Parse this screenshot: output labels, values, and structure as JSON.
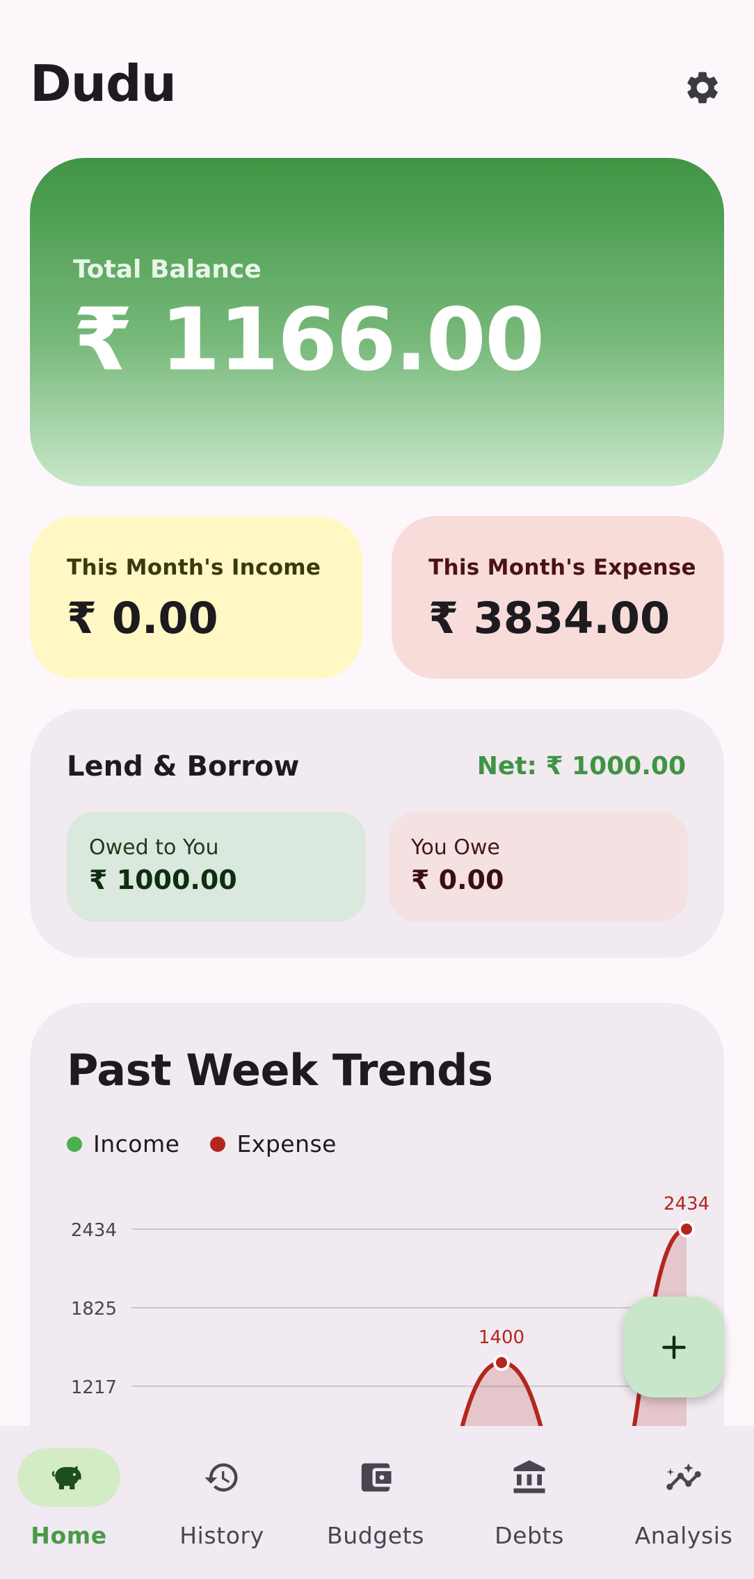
{
  "header": {
    "title": "Dudu",
    "settings_icon": "gear-icon"
  },
  "balance": {
    "label": "Total Balance",
    "value": "₹ 1166.00"
  },
  "income": {
    "label": "This Month's Income",
    "value": "₹ 0.00"
  },
  "expense": {
    "label": "This Month's Expense",
    "value": "₹ 3834.00"
  },
  "lend_borrow": {
    "title": "Lend & Borrow",
    "net": "Net: ₹ 1000.00",
    "owed_to_you": {
      "label": "Owed to You",
      "value": "₹ 1000.00"
    },
    "you_owe": {
      "label": "You Owe",
      "value": "₹ 0.00"
    }
  },
  "trends": {
    "title": "Past Week Trends",
    "legend": {
      "income": "Income",
      "expense": "Expense"
    }
  },
  "chart_data": {
    "type": "area",
    "y_ticks": [
      2434,
      1825,
      1217
    ],
    "ylim": [
      0,
      2434
    ],
    "grid": true,
    "legend_position": "top-left",
    "series": [
      {
        "name": "Income",
        "color": "#4caf50",
        "values": [
          0,
          0,
          0,
          0,
          0,
          0,
          0
        ]
      },
      {
        "name": "Expense",
        "color": "#b3261e",
        "values": [
          0,
          0,
          0,
          0,
          1400,
          0,
          2434
        ]
      }
    ],
    "point_labels": [
      "1400",
      "2434"
    ]
  },
  "fab": {
    "icon": "plus-icon"
  },
  "nav": [
    {
      "label": "Home",
      "icon": "piggy-bank-icon",
      "active": true
    },
    {
      "label": "History",
      "icon": "history-icon",
      "active": false
    },
    {
      "label": "Budgets",
      "icon": "wallet-icon",
      "active": false
    },
    {
      "label": "Debts",
      "icon": "bank-icon",
      "active": false
    },
    {
      "label": "Analysis",
      "icon": "analytics-icon",
      "active": false
    }
  ],
  "colors": {
    "income": "#4caf50",
    "expense": "#b3261e",
    "accent_green": "#3f9443",
    "nav_active": "#d3ecc6"
  }
}
